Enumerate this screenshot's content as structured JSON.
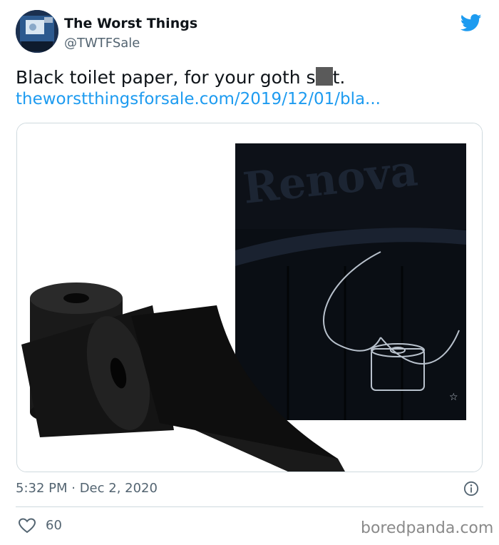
{
  "tweet": {
    "author_name": "The Worst Things",
    "author_handle": "@TWTFSale",
    "text_before": "Black toilet paper, for your goth s",
    "text_after": "t.",
    "link": "theworstthingsforsale.com/2019/12/01/bla...",
    "timestamp": "5:32 PM · Dec 2, 2020",
    "likes": "60",
    "packaging_brand_text": "Renova"
  },
  "watermark": "boredpanda.com",
  "colors": {
    "accent": "#1d9bf0",
    "text": "#0f1419",
    "muted": "#536471",
    "border": "#cfd9de"
  },
  "icons": [
    "twitter-bird-icon",
    "info-icon",
    "heart-icon"
  ]
}
